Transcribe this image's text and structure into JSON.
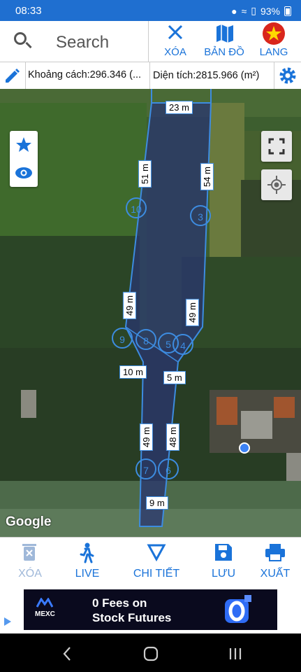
{
  "status": {
    "time": "08:33",
    "battery": "93%"
  },
  "header": {
    "search_placeholder": "Search",
    "buttons": [
      {
        "label": "XÓA",
        "icon": "close-icon"
      },
      {
        "label": "BẢN ĐỒ",
        "icon": "map-icon"
      },
      {
        "label": "LANG",
        "icon": "vietnam-flag-icon"
      }
    ]
  },
  "measure": {
    "distance": "Khoảng cách:296.346 (...",
    "area": "Diện tích:2815.966 (m²)"
  },
  "map": {
    "edge_labels": [
      "23 m",
      "51 m",
      "54 m",
      "49 m",
      "49 m",
      "10 m",
      "5 m",
      "49 m",
      "48 m",
      "9 m"
    ],
    "vertex_labels": [
      "10",
      "3",
      "9",
      "8",
      "5",
      "4",
      "7",
      "6"
    ],
    "attribution": "Google"
  },
  "bottom_nav": [
    {
      "label": "XÓA",
      "icon": "trash-icon",
      "enabled": false
    },
    {
      "label": "LIVE",
      "icon": "walk-icon",
      "enabled": true
    },
    {
      "label": "CHI TIẾT",
      "icon": "triangle-icon",
      "enabled": true
    },
    {
      "label": "LƯU",
      "icon": "save-icon",
      "enabled": true
    },
    {
      "label": "XUẤT",
      "icon": "print-icon",
      "enabled": true
    }
  ],
  "ad": {
    "brand": "MEXC",
    "line1": "0 Fees on",
    "line2": "Stock Futures"
  },
  "colors": {
    "accent": "#1a73d9",
    "status_bar": "#1f6fd0"
  }
}
